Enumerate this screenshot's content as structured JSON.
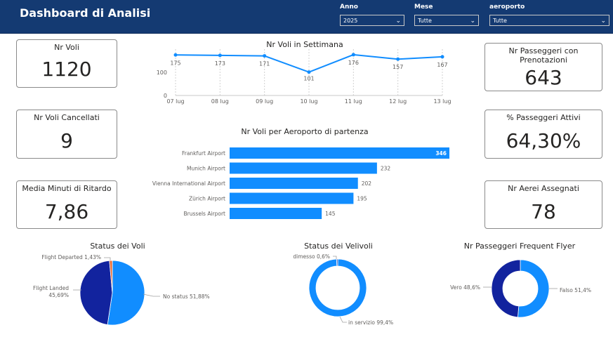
{
  "header": {
    "title": "Dashboard di Analisi"
  },
  "slicers": [
    {
      "label": "Anno",
      "value": "2025"
    },
    {
      "label": "Mese",
      "value": "Tutte"
    },
    {
      "label": "aeroporto",
      "value": "Tutte"
    }
  ],
  "cards": {
    "nr_voli": {
      "title": "Nr Voli",
      "value": "1120"
    },
    "nr_voli_cancellati": {
      "title": "Nr Voli Cancellati",
      "value": "9"
    },
    "media_ritardo": {
      "title": "Media Minuti di Ritardo",
      "value": "7,86"
    },
    "nr_passeggeri_pren": {
      "title": "Nr Passeggeri con Prenotazioni",
      "value": "643"
    },
    "perc_passeggeri_attivi": {
      "title": "% Passeggeri Attivi",
      "value": "64,30%"
    },
    "nr_aerei_assegnati": {
      "title": "Nr Aerei Assegnati",
      "value": "78"
    }
  },
  "colors": {
    "header": "#143a72",
    "primary": "#118dff",
    "dark": "#12239e",
    "red": "#e66c37"
  },
  "chart_data": [
    {
      "type": "line",
      "title": "Nr Voli in Settimana",
      "categories": [
        "07 lug",
        "08 lug",
        "09 lug",
        "10 lug",
        "11 lug",
        "12 lug",
        "13 lug"
      ],
      "values": [
        175,
        173,
        171,
        101,
        176,
        157,
        167
      ],
      "yticks": [
        0,
        100
      ],
      "ylim": [
        0,
        200
      ],
      "grid": true
    },
    {
      "type": "bar",
      "orientation": "horizontal",
      "title": "Nr Voli per Aeroporto di partenza",
      "categories": [
        "Frankfurt Airport",
        "Munich Airport",
        "Vienna International Airport",
        "Zürich Airport",
        "Brussels Airport"
      ],
      "values": [
        346,
        232,
        202,
        195,
        145
      ],
      "xlim": [
        0,
        346
      ]
    },
    {
      "type": "pie",
      "title": "Status dei Voli",
      "slices": [
        {
          "label": "No status",
          "value": 51.88,
          "text": "No status 51,88%",
          "color": "#118dff"
        },
        {
          "label": "Flight Landed",
          "value": 45.69,
          "text": "Flight Landed 45,69%",
          "color": "#12239e"
        },
        {
          "label": "Flight Departed",
          "value": 1.43,
          "text": "Flight Departed 1,43%",
          "color": "#e66c37"
        }
      ]
    },
    {
      "type": "pie",
      "donut": true,
      "title": "Status dei Velivoli",
      "slices": [
        {
          "label": "in servizio",
          "value": 99.4,
          "text": "in servizio 99,4%",
          "color": "#118dff"
        },
        {
          "label": "dimesso",
          "value": 0.6,
          "text": "dimesso 0,6%",
          "color": "#12239e"
        }
      ]
    },
    {
      "type": "pie",
      "donut": true,
      "title": "Nr Passeggeri Frequent Flyer",
      "slices": [
        {
          "label": "Falso",
          "value": 51.4,
          "text": "Falso 51,4%",
          "color": "#118dff"
        },
        {
          "label": "Vero",
          "value": 48.6,
          "text": "Vero 48,6%",
          "color": "#12239e"
        }
      ]
    }
  ]
}
